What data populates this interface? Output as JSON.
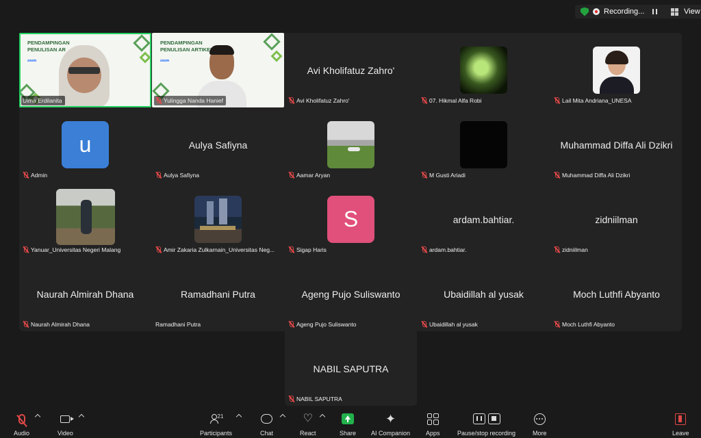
{
  "top_bar": {
    "recording_label": "Recording...",
    "view_label": "View"
  },
  "participants": [
    {
      "id": "ulma",
      "display_name": "Ulma Erdilanita",
      "mic_muted": false,
      "video": true,
      "active_speaker": true
    },
    {
      "id": "yulingga",
      "display_name": "Yulingga Nanda Hanief",
      "mic_muted": true,
      "video": true
    },
    {
      "id": "avi",
      "display_name": "Avi Kholifatuz Zahro'",
      "center_name": "Avi Kholifatuz Zahro'",
      "mic_muted": true
    },
    {
      "id": "hikmal",
      "display_name": "07. Hikmal Alfa Robi",
      "mic_muted": true,
      "picture": true
    },
    {
      "id": "lail",
      "display_name": "Lail Mita Andriana_UNESA",
      "mic_muted": true,
      "picture": true
    },
    {
      "id": "admin",
      "display_name": "Admin",
      "mic_muted": true,
      "avatar_letter": "u",
      "avatar_color": "#3b7fd6"
    },
    {
      "id": "aulya",
      "display_name": "Aulya Safiyna",
      "center_name": "Aulya Safiyna",
      "mic_muted": true
    },
    {
      "id": "aamar",
      "display_name": "Aamar Aryan",
      "mic_muted": true,
      "picture": true
    },
    {
      "id": "gusti",
      "display_name": "M Gusti Ariadi",
      "mic_muted": true,
      "picture": true
    },
    {
      "id": "diffa",
      "display_name": "Muhammad Diffa Ali Dzikri",
      "center_name": "Muhammad Diffa Ali Dzikri",
      "mic_muted": true
    },
    {
      "id": "yanuar",
      "display_name": "Yanuar_Universitas Negeri Malang",
      "mic_muted": true,
      "picture": true
    },
    {
      "id": "amir",
      "display_name": "Amir Zakaria Zulkarnain_Universitas Neg...",
      "mic_muted": true,
      "picture": true
    },
    {
      "id": "sigap",
      "display_name": "Sigap Haris",
      "mic_muted": true,
      "avatar_letter": "S",
      "avatar_color": "#e0507a"
    },
    {
      "id": "ardam",
      "display_name": "ardam.bahtiar.",
      "center_name": "ardam.bahtiar.",
      "mic_muted": true
    },
    {
      "id": "zidni",
      "display_name": "zidniilman",
      "center_name": "zidniilman",
      "mic_muted": true
    },
    {
      "id": "naurah",
      "display_name": "Naurah Almirah Dhana",
      "center_name": "Naurah Almirah Dhana",
      "mic_muted": true
    },
    {
      "id": "ramadhani",
      "display_name": "Ramadhani Putra",
      "center_name": "Ramadhani Putra",
      "mic_muted": false
    },
    {
      "id": "ageng",
      "display_name": "Ageng Pujo Suliswanto",
      "center_name": "Ageng Pujo Suliswanto",
      "mic_muted": true
    },
    {
      "id": "ubaidillah",
      "display_name": "Ubaidillah al yusak",
      "center_name": "Ubaidillah al yusak",
      "mic_muted": true
    },
    {
      "id": "luthfi",
      "display_name": "Moch Luthfi Abyanto",
      "center_name": "Moch Luthfi Abyanto",
      "mic_muted": true
    },
    {
      "id": "nabil",
      "display_name": "NABIL SAPUTRA",
      "center_name": "NABIL SAPUTRA",
      "mic_muted": true
    }
  ],
  "banner": {
    "title_line1": "PENDAMPINGAN",
    "title_line2_a": "PENULISAN AR",
    "title_line2_b": "PENULISAN ARTIKEL",
    "zoom_text": "zoom"
  },
  "toolbar": {
    "audio": "Audio",
    "video": "Video",
    "participants": "Participants",
    "participants_count": "21",
    "chat": "Chat",
    "react": "React",
    "share": "Share",
    "ai_companion": "AI Companion",
    "apps": "Apps",
    "pause_stop_recording": "Pause/stop recording",
    "more": "More",
    "leave": "Leave"
  },
  "colors": {
    "active_speaker_border": "#23d160",
    "share_green": "#22b14c",
    "muted_red": "#e04848"
  }
}
